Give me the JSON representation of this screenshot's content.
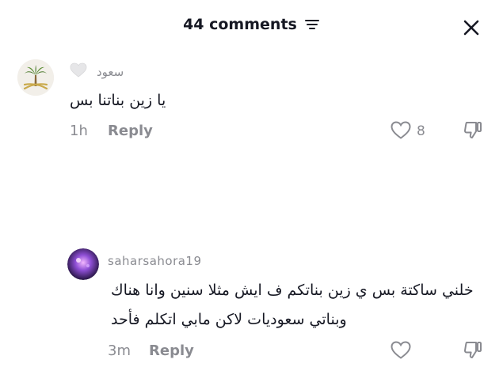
{
  "header": {
    "title": "44 comments"
  },
  "comments": [
    {
      "username": "سعود",
      "text": "يا زين بناتنا بس",
      "time": "1h",
      "reply_label": "Reply",
      "like_count": "8"
    },
    {
      "username": "saharsahora19",
      "text_line1": "خلني ساكتة بس ي زين بناتكم ف ايش مثلا سنين وانا هناك",
      "text_line2": "وبناتي سعوديات لاكن مابي اتكلم فأحد",
      "time": "3m",
      "reply_label": "Reply"
    }
  ],
  "colors": {
    "accent_text": "#161823",
    "muted": "#8a8b91",
    "badge_heart": "#e6e6e8"
  }
}
